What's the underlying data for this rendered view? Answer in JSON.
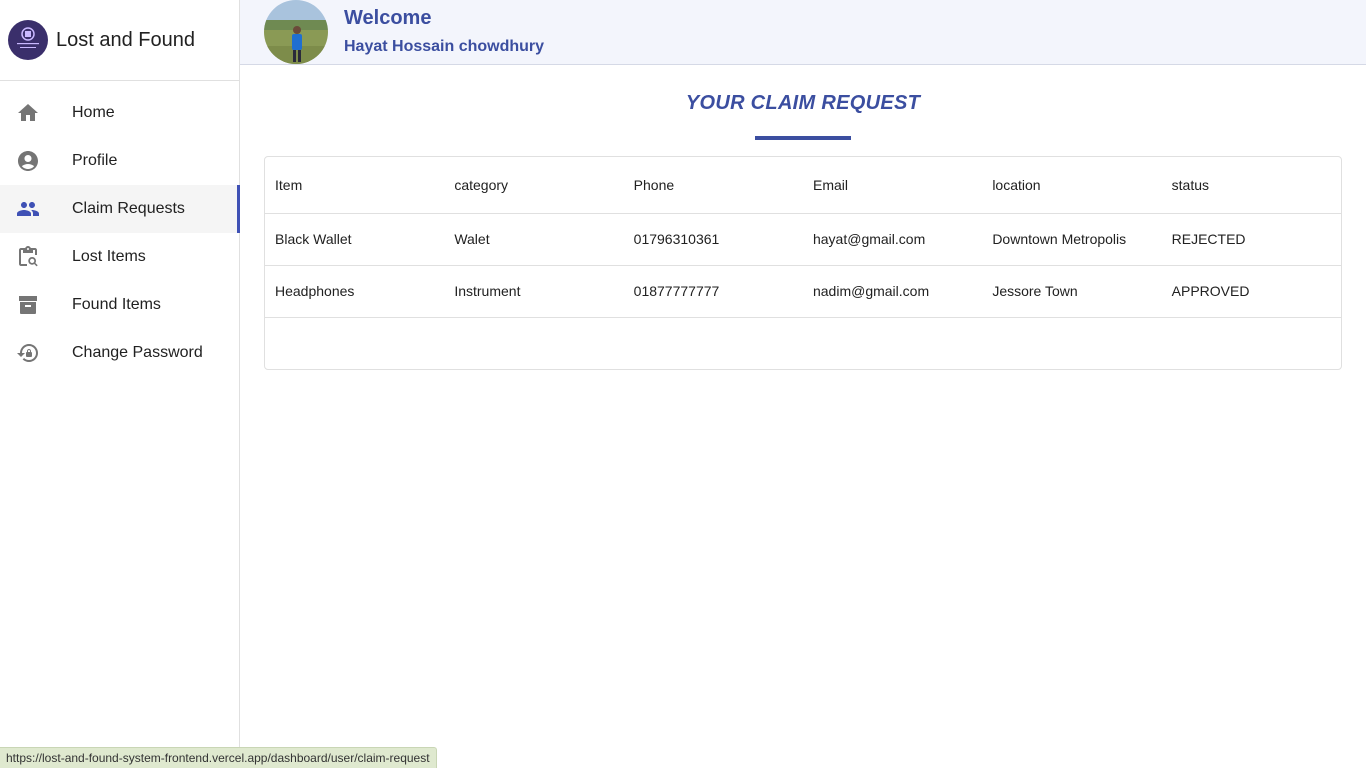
{
  "brand": {
    "title": "Lost and Found",
    "logo_icon": "lost-and-found-logo"
  },
  "sidebar": {
    "items": [
      {
        "label": "Home",
        "icon": "home-icon"
      },
      {
        "label": "Profile",
        "icon": "account-circle-icon"
      },
      {
        "label": "Claim Requests",
        "icon": "people-icon",
        "active": true
      },
      {
        "label": "Lost Items",
        "icon": "clipboard-search-icon"
      },
      {
        "label": "Found Items",
        "icon": "archive-box-icon"
      },
      {
        "label": "Change Password",
        "icon": "lock-reset-icon"
      }
    ]
  },
  "header": {
    "welcome": "Welcome",
    "user_name": "Hayat Hossain chowdhury"
  },
  "main": {
    "title": "YOUR CLAIM REQUEST",
    "table": {
      "columns": [
        "Item",
        "category",
        "Phone",
        "Email",
        "location",
        "status"
      ],
      "rows": [
        [
          "Black Wallet",
          "Walet",
          "01796310361",
          "hayat@gmail.com",
          "Downtown Metropolis",
          "REJECTED"
        ],
        [
          "Headphones",
          "Instrument",
          "01877777777",
          "nadim@gmail.com",
          "Jessore Town",
          "APPROVED"
        ]
      ]
    }
  },
  "statusbar": {
    "url": "https://lost-and-found-system-frontend.vercel.app/dashboard/user/claim-request"
  },
  "colors": {
    "accent": "#3b4ea0",
    "header_bg": "#f3f5fc",
    "icon_gray": "#757575"
  }
}
